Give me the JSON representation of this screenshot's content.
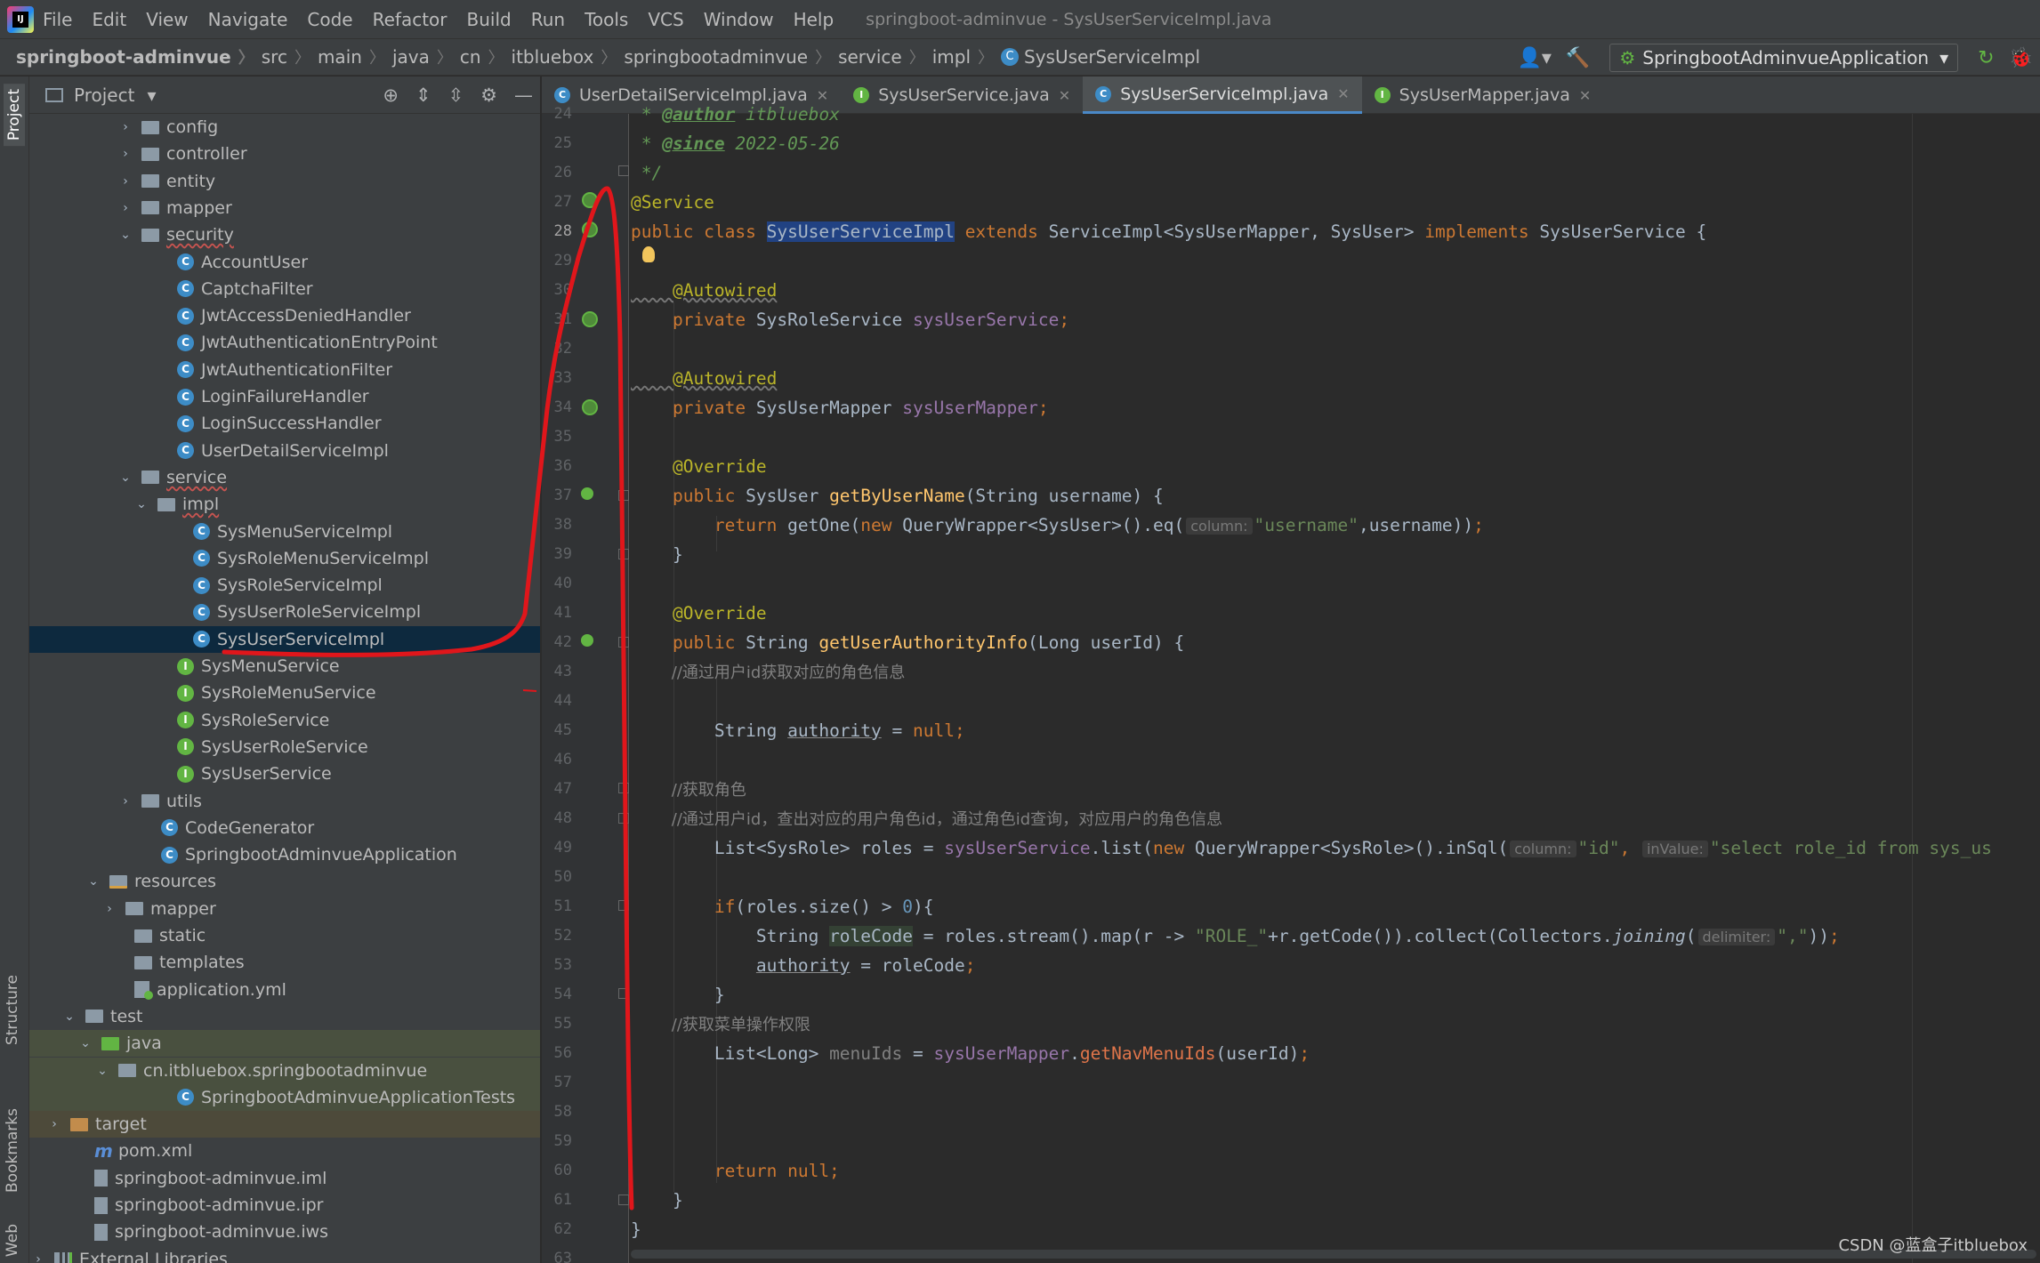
{
  "menubar": {
    "items": [
      "File",
      "Edit",
      "View",
      "Navigate",
      "Code",
      "Refactor",
      "Build",
      "Run",
      "Tools",
      "VCS",
      "Window",
      "Help"
    ],
    "title": "springboot-adminvue - SysUserServiceImpl.java"
  },
  "breadcrumb": [
    "springboot-adminvue",
    "src",
    "main",
    "java",
    "cn",
    "itbluebox",
    "springbootadminvue",
    "service",
    "impl",
    "SysUserServiceImpl"
  ],
  "run_config": "SpringbootAdminvueApplication",
  "left_strip": {
    "project": "Project",
    "structure": "Structure",
    "bookmarks": "Bookmarks",
    "web": "Web"
  },
  "project_panel": {
    "title": "Project",
    "tree": [
      {
        "label": "config",
        "icon": "folder-icon",
        "chev": "›"
      },
      {
        "label": "controller",
        "icon": "folder-icon",
        "chev": "›"
      },
      {
        "label": "entity",
        "icon": "folder-icon",
        "chev": "›"
      },
      {
        "label": "mapper",
        "icon": "folder-icon",
        "chev": "›"
      },
      {
        "label": "security",
        "icon": "folder-icon",
        "chev": "⌄"
      },
      {
        "label": "AccountUser",
        "icon": "class-icon"
      },
      {
        "label": "CaptchaFilter",
        "icon": "class-icon"
      },
      {
        "label": "JwtAccessDeniedHandler",
        "icon": "class-icon"
      },
      {
        "label": "JwtAuthenticationEntryPoint",
        "icon": "class-icon"
      },
      {
        "label": "JwtAuthenticationFilter",
        "icon": "class-icon"
      },
      {
        "label": "LoginFailureHandler",
        "icon": "class-icon"
      },
      {
        "label": "LoginSuccessHandler",
        "icon": "class-icon"
      },
      {
        "label": "UserDetailServiceImpl",
        "icon": "class-icon"
      },
      {
        "label": "service",
        "icon": "folder-icon",
        "chev": "⌄"
      },
      {
        "label": "impl",
        "icon": "folder-icon",
        "chev": "⌄"
      },
      {
        "label": "SysMenuServiceImpl",
        "icon": "class-icon"
      },
      {
        "label": "SysRoleMenuServiceImpl",
        "icon": "class-icon"
      },
      {
        "label": "SysRoleServiceImpl",
        "icon": "class-icon"
      },
      {
        "label": "SysUserRoleServiceImpl",
        "icon": "class-icon"
      },
      {
        "label": "SysUserServiceImpl",
        "icon": "class-icon",
        "selected": true
      },
      {
        "label": "SysMenuService",
        "icon": "interface-icon"
      },
      {
        "label": "SysRoleMenuService",
        "icon": "interface-icon"
      },
      {
        "label": "SysRoleService",
        "icon": "interface-icon"
      },
      {
        "label": "SysUserRoleService",
        "icon": "interface-icon"
      },
      {
        "label": "SysUserService",
        "icon": "interface-icon"
      },
      {
        "label": "utils",
        "icon": "folder-icon",
        "chev": "›"
      },
      {
        "label": "CodeGenerator",
        "icon": "class-icon"
      },
      {
        "label": "SpringbootAdminvueApplication",
        "icon": "class-icon"
      },
      {
        "label": "resources",
        "icon": "resources-folder-icon",
        "chev": "⌄"
      },
      {
        "label": "mapper",
        "icon": "folder-icon",
        "chev": "›"
      },
      {
        "label": "static",
        "icon": "folder-icon"
      },
      {
        "label": "templates",
        "icon": "folder-icon"
      },
      {
        "label": "application.yml",
        "icon": "yml-icon"
      },
      {
        "label": "test",
        "icon": "folder-icon",
        "chev": "⌄"
      },
      {
        "label": "java",
        "icon": "test-folder-icon",
        "chev": "⌄"
      },
      {
        "label": "cn.itbluebox.springbootadminvue",
        "icon": "folder-icon",
        "chev": "⌄"
      },
      {
        "label": "SpringbootAdminvueApplicationTests",
        "icon": "class-icon"
      },
      {
        "label": "target",
        "icon": "target-folder-icon",
        "chev": "›"
      },
      {
        "label": "pom.xml",
        "icon": "maven-icon"
      },
      {
        "label": "springboot-adminvue.iml",
        "icon": "file-icon"
      },
      {
        "label": "springboot-adminvue.ipr",
        "icon": "file-icon"
      },
      {
        "label": "springboot-adminvue.iws",
        "icon": "file-icon"
      },
      {
        "label": "External Libraries",
        "icon": "library-icon",
        "chev": "›"
      }
    ]
  },
  "tabs": [
    {
      "label": "UserDetailServiceImpl.java",
      "icon": "class-icon"
    },
    {
      "label": "SysUserService.java",
      "icon": "interface-icon"
    },
    {
      "label": "SysUserServiceImpl.java",
      "icon": "class-icon",
      "active": true
    },
    {
      "label": "SysUserMapper.java",
      "icon": "interface-icon"
    }
  ],
  "line_numbers": [
    "24",
    "25",
    "26",
    "27",
    "28",
    "29",
    "30",
    "31",
    "32",
    "33",
    "34",
    "35",
    "36",
    "37",
    "38",
    "39",
    "40",
    "41",
    "42",
    "43",
    "44",
    "45",
    "46",
    "47",
    "48",
    "49",
    "50",
    "51",
    "52",
    "53",
    "54",
    "55",
    "56",
    "57",
    "58",
    "59",
    "60",
    "61",
    "62",
    "63"
  ],
  "code": {
    "l24a": " * ",
    "l24b": "@author",
    "l24c": " itbluebox",
    "l25a": " * ",
    "l25b": "@since",
    "l25c": " 2022-05-26",
    "l26": " */",
    "l27": "@Service",
    "l28a": "public class ",
    "l28b": "SysUserServiceImpl",
    "l28c": " extends ",
    "l28d": "ServiceImpl<SysUserMapper, SysUser> ",
    "l28e": "implements ",
    "l28f": "SysUserService {",
    "l30": "    @Autowired",
    "l31a": "    private ",
    "l31b": "SysRoleService ",
    "l31c": "sysUserService",
    "l31d": ";",
    "l33": "    @Autowired",
    "l34a": "    private ",
    "l34b": "SysUserMapper ",
    "l34c": "sysUserMapper",
    "l34d": ";",
    "l36": "    @Override",
    "l37a": "    public ",
    "l37b": "SysUser ",
    "l37c": "getByUserName",
    "l37d": "(String username) {",
    "l38a": "        return ",
    "l38b": "getOne(",
    "l38c": "new ",
    "l38d": "QueryWrapper<SysUser>().eq(",
    "l38h": "column:",
    "l38e": "\"username\"",
    "l38f": ",username))",
    "l38g": ";",
    "l39": "    }",
    "l41": "    @Override",
    "l42a": "    public ",
    "l42b": "String ",
    "l42c": "getUserAuthorityInfo",
    "l42d": "(Long userId) {",
    "l43": "        //通过用户id获取对应的角色信息",
    "l45a": "        String ",
    "l45b": "authority",
    "l45c": " = ",
    "l45d": "null;",
    "l47": "        //获取角色",
    "l48": "        //通过用户id，查出对应的用户角色id，通过角色id查询，对应用户的角色信息",
    "l49a": "        List<SysRole> roles = ",
    "l49b": "sysUserService",
    "l49c": ".list(",
    "l49d": "new ",
    "l49e": "QueryWrapper<SysRole>().inSql(",
    "l49h1": "column:",
    "l49f": "\"id\"",
    "l49g": ", ",
    "l49h2": "inValue:",
    "l49i": "\"select role_id from sys_us",
    "l51a": "        ",
    "l51b": "if",
    "l51c": "(roles.size() > ",
    "l51d": "0",
    "l51e": "){",
    "l52a": "            String ",
    "l52b": "roleCode",
    "l52c": " = roles.stream().map(r -> ",
    "l52d": "\"ROLE_\"",
    "l52e": "+r.getCode()).collect(Collectors.",
    "l52f": "joining",
    "l52g": "(",
    "l52h": "delimiter:",
    "l52i": "\",\"",
    "l52j": "))",
    "l52k": ";",
    "l53a": "            ",
    "l53b": "authority",
    "l53c": " = roleCode",
    "l53d": ";",
    "l54": "        }",
    "l55": "        //获取菜单操作权限",
    "l56a": "        List<Long> ",
    "l56b": "menuIds",
    "l56c": " = ",
    "l56d": "sysUserMapper",
    "l56e": ".",
    "l56f": "getNavMenuIds",
    "l56g": "(userId)",
    "l56h": ";",
    "l60a": "        ",
    "l60b": "return null;",
    "l61": "    }",
    "l62": "}"
  },
  "watermark": "CSDN @蓝盒子itbluebox",
  "colors": {
    "keyword": "#cc7832",
    "annotation": "#bbb529",
    "method": "#ffc66d",
    "field": "#9876aa",
    "string": "#6a8759",
    "number": "#6897bb",
    "comment": "#808080",
    "selection": "#214283",
    "annotation_red": "#e0161b"
  }
}
